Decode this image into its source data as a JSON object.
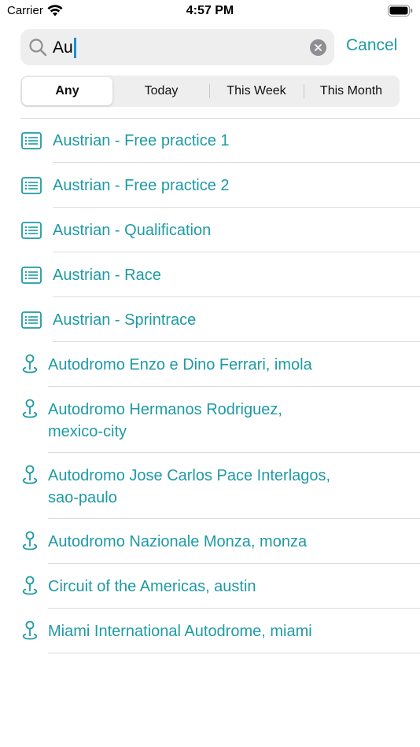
{
  "status_bar": {
    "carrier": "Carrier",
    "time": "4:57 PM"
  },
  "search": {
    "query": "Au",
    "cancel_label": "Cancel"
  },
  "filter": {
    "options": [
      "Any",
      "Today",
      "This Week",
      "This Month"
    ],
    "selected": "Any"
  },
  "colors": {
    "accent": "#1e9aa4",
    "separator": "#dcdcdc",
    "field_background": "#eeeeef"
  },
  "results": [
    {
      "kind": "session",
      "icon": "list-document-icon",
      "lines": [
        "Austrian - Free practice 1"
      ]
    },
    {
      "kind": "session",
      "icon": "list-document-icon",
      "lines": [
        "Austrian - Free practice 2"
      ]
    },
    {
      "kind": "session",
      "icon": "list-document-icon",
      "lines": [
        "Austrian - Qualification"
      ]
    },
    {
      "kind": "session",
      "icon": "list-document-icon",
      "lines": [
        "Austrian - Race"
      ]
    },
    {
      "kind": "session",
      "icon": "list-document-icon",
      "lines": [
        "Austrian - Sprintrace"
      ]
    },
    {
      "kind": "location",
      "icon": "map-pin-icon",
      "lines": [
        "Autodromo Enzo e Dino Ferrari, imola"
      ]
    },
    {
      "kind": "location",
      "icon": "map-pin-icon",
      "lines": [
        "Autodromo Hermanos Rodriguez,",
        "mexico-city"
      ]
    },
    {
      "kind": "location",
      "icon": "map-pin-icon",
      "lines": [
        "Autodromo Jose Carlos Pace Interlagos,",
        "sao-paulo"
      ]
    },
    {
      "kind": "location",
      "icon": "map-pin-icon",
      "lines": [
        "Autodromo Nazionale Monza, monza"
      ]
    },
    {
      "kind": "location",
      "icon": "map-pin-icon",
      "lines": [
        "Circuit of the Americas, austin"
      ]
    },
    {
      "kind": "location",
      "icon": "map-pin-icon",
      "lines": [
        "Miami International Autodrome, miami"
      ]
    }
  ]
}
